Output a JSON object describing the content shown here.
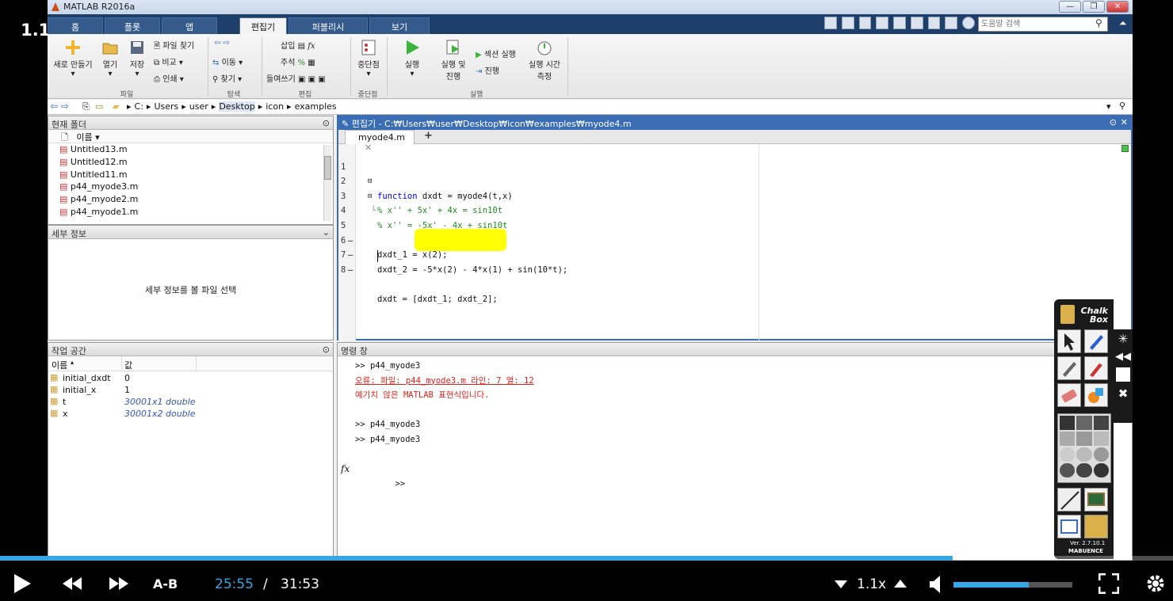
{
  "speed_badge": "1.10",
  "window": {
    "title": "MATLAB R2016a",
    "min": "—",
    "max": "❐",
    "close": "✕"
  },
  "tabs": [
    "홈",
    "플롯",
    "앱",
    "편집기",
    "퍼블리시",
    "보기"
  ],
  "active_tab": "편집기",
  "search": {
    "placeholder": "도움말 검색"
  },
  "ribbon": {
    "new": "새로 만들기",
    "open": "열기",
    "save": "저장",
    "find_files": "파일 찾기",
    "compare": "비교",
    "print": "인쇄",
    "goto": "이동",
    "find": "찾기",
    "insert": "삽입",
    "comment": "주석",
    "indent": "들여쓰기",
    "breakpoints": "중단점",
    "run": "실행",
    "run_advance_1": "실행 및",
    "run_advance_2": "진행",
    "run_section": "섹션 실행",
    "advance": "진행",
    "run_time_1": "실행 시간",
    "run_time_2": "측정",
    "sections": {
      "file": "파일",
      "nav": "탐색",
      "edit": "편집",
      "bp": "중단점",
      "run": "실행"
    }
  },
  "address": {
    "parts": [
      "C:",
      "Users",
      "user",
      "Desktop",
      "icon",
      "examples"
    ]
  },
  "current_folder": {
    "title": "현재 폴더",
    "col_name": "이름",
    "files": [
      "Untitled13.m",
      "Untitled12.m",
      "Untitled11.m",
      "p44_myode3.m",
      "p44_myode2.m",
      "p44_myode1.m"
    ]
  },
  "details": {
    "title": "세부 정보",
    "message": "세부 정보를 볼 파일 선택"
  },
  "workspace": {
    "title": "작업 공간",
    "col_name": "이름",
    "col_value": "값",
    "rows": [
      {
        "name": "initial_dxdt",
        "value": "0"
      },
      {
        "name": "initial_x",
        "value": "1"
      },
      {
        "name": "t",
        "value": "30001x1 double"
      },
      {
        "name": "x",
        "value": "30001x2 double"
      }
    ]
  },
  "editor": {
    "title": "편집기 - C:₩Users₩user₩Desktop₩icon₩examples₩myode4.m",
    "tab": "myode4.m",
    "lines": [
      {
        "n": "1",
        "mark": "",
        "code": "function dxdt = myode4(t,x)"
      },
      {
        "n": "2",
        "mark": "",
        "code": "% x'' + 5x' + 4x = sin10t"
      },
      {
        "n": "3",
        "mark": "",
        "code": "% x'' = -5x' - 4x + sin10t"
      },
      {
        "n": "4",
        "mark": "",
        "code": ""
      },
      {
        "n": "5",
        "mark": "—",
        "code": "dxdt_1 = x(2);"
      },
      {
        "n": "6",
        "mark": "—",
        "code": "dxdt_2 = -5*x(2) - 4*x(1) + sin(10*t);"
      },
      {
        "n": "7",
        "mark": "—",
        "code": "dxdt = [dxdt_1; dxdt_2];"
      },
      {
        "n": "8",
        "mark": "",
        "code": ""
      }
    ]
  },
  "command": {
    "title": "명령 창",
    "lines": [
      {
        "text": ">> p44_myode3",
        "err": false
      },
      {
        "text": "오류: 파일: p44_myode3.m 라인: 7 열: 12",
        "err": true
      },
      {
        "text": "예기치 않은 MATLAB 표현식입니다.",
        "err": true
      },
      {
        "text": "",
        "err": false
      },
      {
        "text": ">> p44_myode3",
        "err": false
      },
      {
        "text": ">> p44_myode3",
        "err": false
      }
    ],
    "prompt": ">>",
    "fx": "fx"
  },
  "chalkbox": {
    "title_1": "Chalk",
    "title_2": "Box",
    "version": "Ver. 2.7.10.1",
    "brand": "MABUENCE"
  },
  "player": {
    "progress": 0.812,
    "ab": "A-B",
    "current": "25:55",
    "separator": "/",
    "duration": "31:53",
    "speed": "1.1x",
    "volume": 0.63
  },
  "colors": {
    "accent": "#35a7e6",
    "highlight": "#ffff00",
    "error": "#e0221b"
  }
}
